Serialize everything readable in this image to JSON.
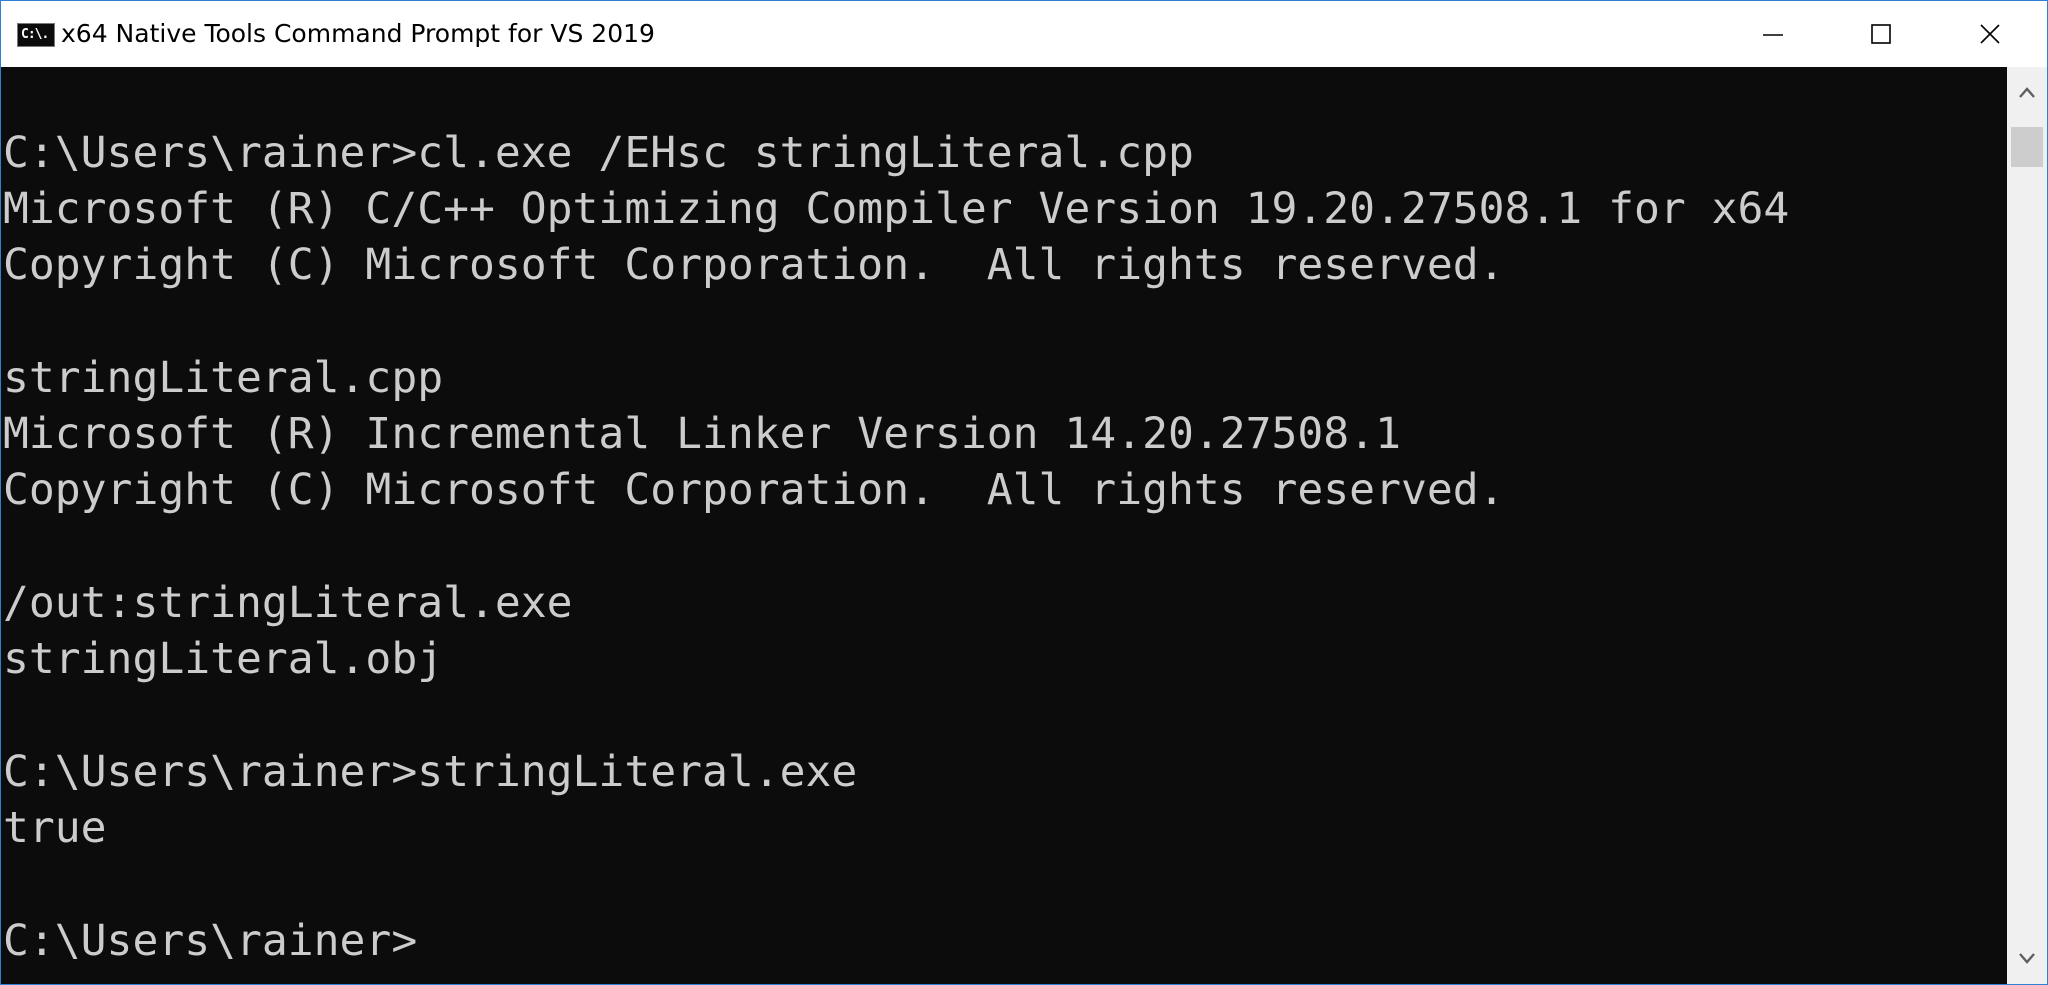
{
  "window": {
    "title": "x64 Native Tools Command Prompt for VS 2019",
    "icon_label": "C:\\.",
    "icon": "console-icon",
    "controls": {
      "minimize": "minimize-icon",
      "maximize": "maximize-icon",
      "close": "close-icon"
    }
  },
  "console": {
    "lines": [
      "C:\\Users\\rainer>cl.exe /EHsc stringLiteral.cpp",
      "Microsoft (R) C/C++ Optimizing Compiler Version 19.20.27508.1 for x64",
      "Copyright (C) Microsoft Corporation.  All rights reserved.",
      "",
      "stringLiteral.cpp",
      "Microsoft (R) Incremental Linker Version 14.20.27508.1",
      "Copyright (C) Microsoft Corporation.  All rights reserved.",
      "",
      "/out:stringLiteral.exe",
      "stringLiteral.obj",
      "",
      "C:\\Users\\rainer>stringLiteral.exe",
      "true",
      "",
      "C:\\Users\\rainer>"
    ],
    "text_color": "#cccccc",
    "background_color": "#0c0c0c"
  },
  "scrollbar": {
    "up_icon": "chevron-up-icon",
    "down_icon": "chevron-down-icon"
  }
}
